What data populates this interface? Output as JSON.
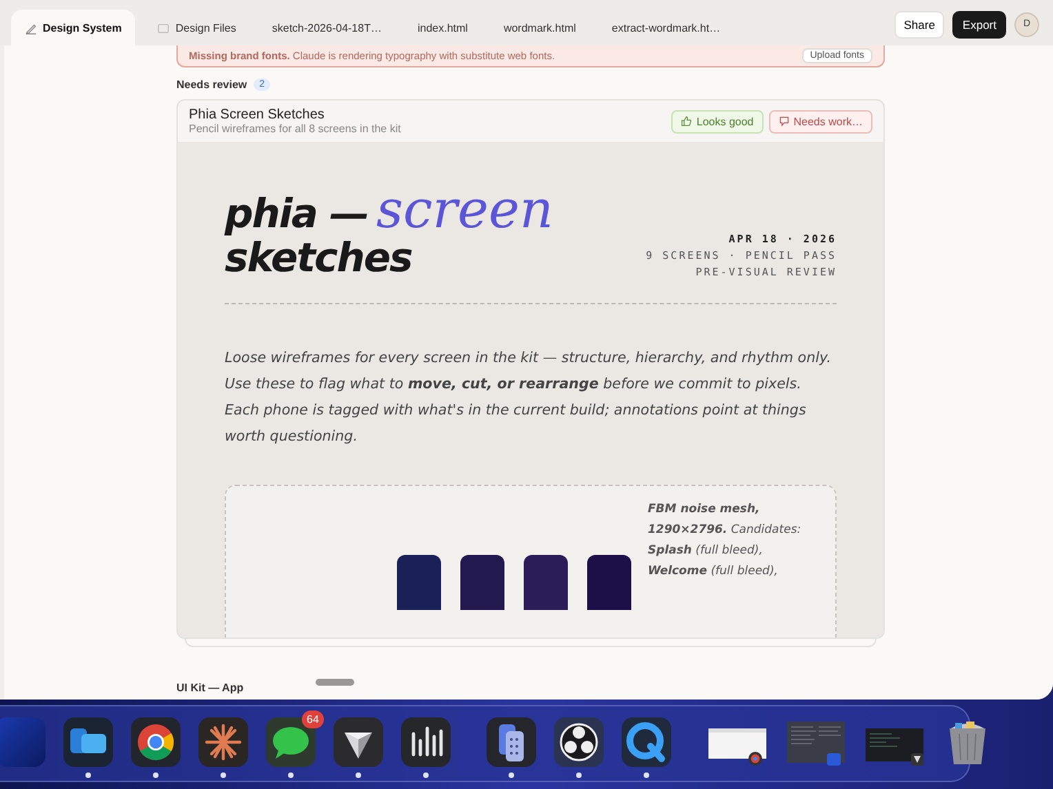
{
  "tabs": [
    {
      "label": "Design System",
      "selected": true,
      "kind": "pen"
    },
    {
      "label": "Design Files",
      "selected": false,
      "kind": "file"
    },
    {
      "label": "sketch-2026-04-18T…",
      "selected": false,
      "kind": "plain"
    },
    {
      "label": "index.html",
      "selected": false,
      "kind": "plain"
    },
    {
      "label": "wordmark.html",
      "selected": false,
      "kind": "plain"
    },
    {
      "label": "extract-wordmark.ht…",
      "selected": false,
      "kind": "plain"
    }
  ],
  "actions": {
    "share": "Share",
    "export": "Export",
    "avatar": "D"
  },
  "alert": {
    "text": "**Missing brand fonts.** Claude is rendering typography with substitute web fonts.",
    "button": "Upload fonts"
  },
  "review": {
    "heading": "Needs review",
    "count": "2",
    "card": {
      "title": "Phia Screen Sketches",
      "subtitle": "Pencil wireframes for all 8 screens in the kit",
      "approve": "Looks good",
      "reject": "Needs work…"
    }
  },
  "sketch": {
    "title_start": "phia —",
    "title_accent": "screen",
    "title_end": "sketches",
    "meta": [
      "APR 18 · 2026",
      "9 SCREENS · PENCIL PASS",
      "PRE-VISUAL REVIEW"
    ],
    "intro": "Loose wireframes for every screen in the kit — structure, hierarchy, and rhythm only. Use these to flag what to **move, cut, or rearrange** before we commit to pixels. Each phone is tagged with what's in the current build; annotations point at things worth questioning.",
    "swatches": [
      {
        "color": "#1a2058"
      },
      {
        "color": "#22194f"
      },
      {
        "color": "#2a1d58"
      },
      {
        "color": "#1d0f47"
      }
    ],
    "note": "**FBM noise mesh, 1290×2796.** Candidates: **Splash** (full bleed), **Welcome** (full bleed),"
  },
  "next_section": "UI Kit — App",
  "dock": [
    {
      "kind": "finder",
      "running": false
    },
    {
      "kind": "windows",
      "running": true
    },
    {
      "kind": "chrome",
      "running": true
    },
    {
      "kind": "burst",
      "running": true
    },
    {
      "kind": "messages",
      "running": true,
      "badge": "64"
    },
    {
      "kind": "cube",
      "running": true
    },
    {
      "kind": "bars",
      "running": true
    },
    {
      "kind": "divider"
    },
    {
      "kind": "phone",
      "running": true
    },
    {
      "kind": "obs",
      "running": true
    },
    {
      "kind": "quicktime",
      "running": true
    },
    {
      "kind": "divider"
    },
    {
      "kind": "thumb-browser",
      "running": false
    },
    {
      "kind": "thumb-doc",
      "running": false
    },
    {
      "kind": "thumb-terminal",
      "running": false
    },
    {
      "kind": "trash",
      "running": false
    }
  ]
}
